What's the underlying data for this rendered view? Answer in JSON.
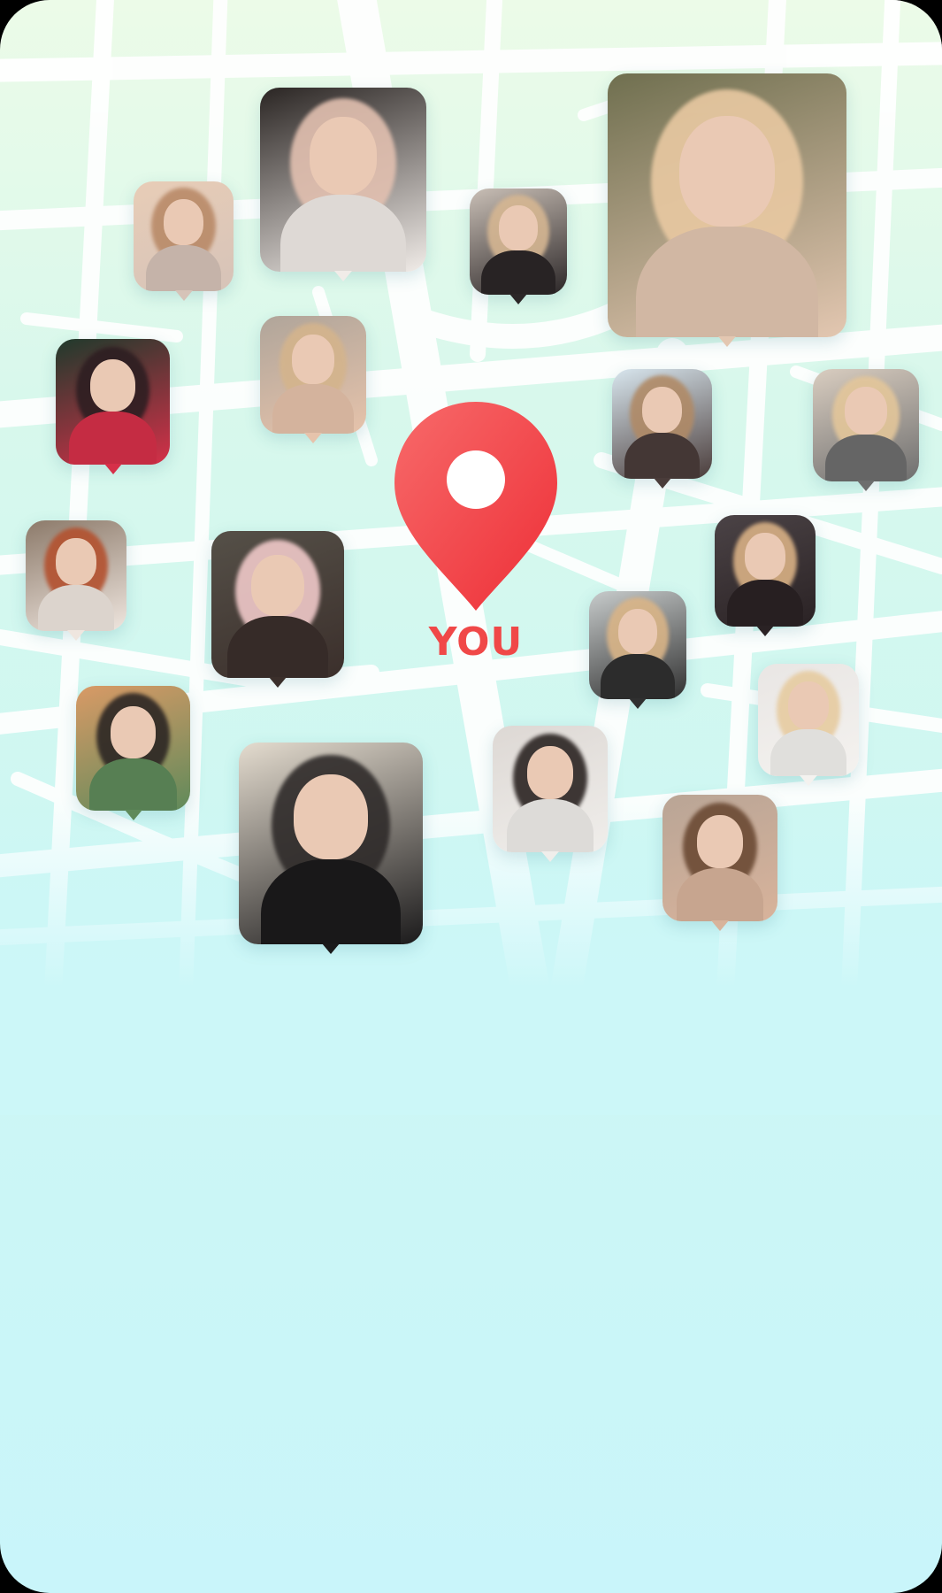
{
  "you_label": "YOU",
  "pin": {
    "color": "#f24444",
    "icon": "map-pin-icon"
  },
  "map": {
    "road_color": "#ffffff",
    "background_color": "#d3f7ee"
  },
  "profiles": [
    {
      "name": "profile-1",
      "palette": [
        "#e8cdb7",
        "#b98a68",
        "#d6c3b8"
      ]
    },
    {
      "name": "profile-2",
      "palette": [
        "#2a2523",
        "#e2c0b0",
        "#f1ece8"
      ]
    },
    {
      "name": "profile-3",
      "palette": [
        "#c9bfb6",
        "#d5b692",
        "#2b2627"
      ]
    },
    {
      "name": "profile-4",
      "palette": [
        "#6f6f4f",
        "#e9c9a2",
        "#e3c7b1"
      ]
    },
    {
      "name": "profile-5",
      "palette": [
        "#1f3a2c",
        "#2e1e22",
        "#d63049"
      ]
    },
    {
      "name": "profile-6",
      "palette": [
        "#b0a59a",
        "#d4b48c",
        "#e6c3ab"
      ]
    },
    {
      "name": "profile-7",
      "palette": [
        "#d8e6ee",
        "#b08a66",
        "#4a3c3a"
      ]
    },
    {
      "name": "profile-8",
      "palette": [
        "#d9cdc0",
        "#e3c69a",
        "#6e6e6e"
      ]
    },
    {
      "name": "profile-9",
      "palette": [
        "#8c7a6a",
        "#b3512f",
        "#efe6df"
      ]
    },
    {
      "name": "profile-10",
      "palette": [
        "#555048",
        "#f0c9c9",
        "#3b2f2b"
      ]
    },
    {
      "name": "profile-11",
      "palette": [
        "#4b4346",
        "#d9b185",
        "#2a2224"
      ]
    },
    {
      "name": "profile-12",
      "palette": [
        "#c7cbcb",
        "#d9b487",
        "#303030"
      ]
    },
    {
      "name": "profile-13",
      "palette": [
        "#d99a66",
        "#2c2624",
        "#5f8a5a"
      ]
    },
    {
      "name": "profile-14",
      "palette": [
        "#e4dccf",
        "#2f2b2a",
        "#1b1a1b"
      ]
    },
    {
      "name": "profile-15",
      "palette": [
        "#ddd8d4",
        "#2b2422",
        "#f0eeeb"
      ]
    },
    {
      "name": "profile-16",
      "palette": [
        "#e9e6e4",
        "#e6cba0",
        "#f4f2ef"
      ]
    },
    {
      "name": "profile-17",
      "palette": [
        "#b9a596",
        "#6b4a34",
        "#d8b39b"
      ]
    }
  ]
}
